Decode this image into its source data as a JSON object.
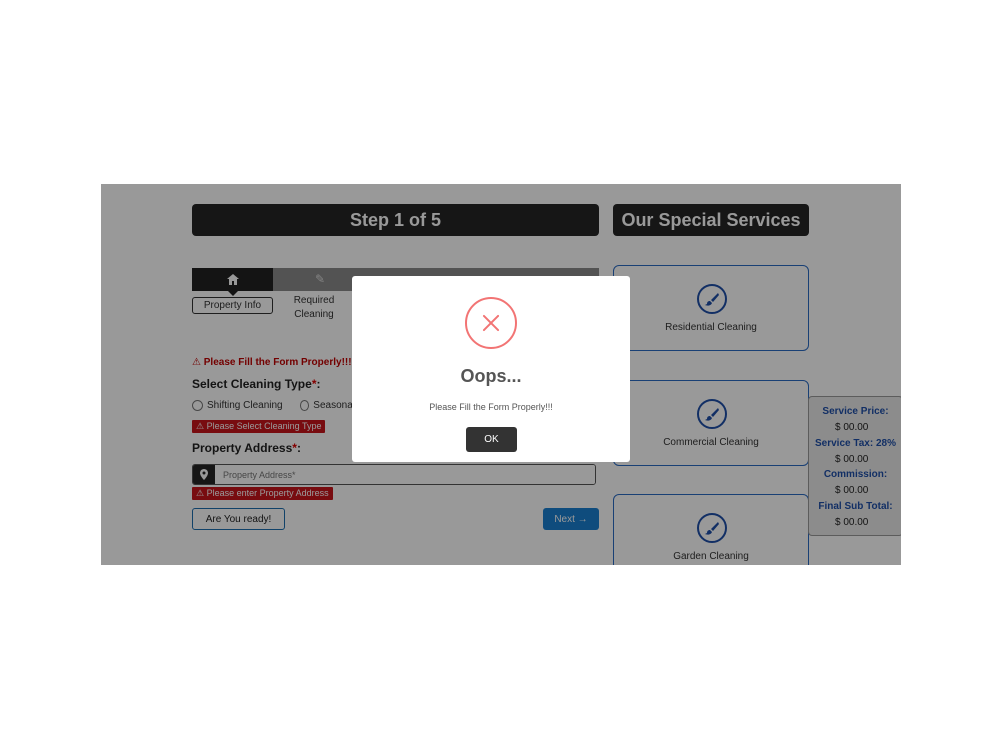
{
  "step": {
    "title": "Step 1 of 5",
    "tabs": [
      {
        "label": "Property Info",
        "icon": "home-icon"
      },
      {
        "label": "Required Cleaning",
        "icon": "brush-icon"
      }
    ]
  },
  "form": {
    "error_banner": "⚠ Please Fill the Form Properly!!!",
    "cleaning_type": {
      "label": "Select Cleaning Type",
      "required_mark": "*",
      "suffix": ":",
      "options": [
        "Shifting Cleaning",
        "Seasonal"
      ],
      "error": "⚠ Please Select Cleaning Type"
    },
    "address": {
      "label": "Property Address",
      "required_mark": "*",
      "suffix": ":",
      "placeholder": "Property Address*",
      "error": "⚠ Please enter Property Address"
    },
    "ready_button": "Are You ready!",
    "next_button": "Next →"
  },
  "services": {
    "title": "Our Special Services",
    "items": [
      {
        "label": "Residential Cleaning",
        "icon": "brush-icon"
      },
      {
        "label": "Commercial Cleaning",
        "icon": "brush-icon"
      },
      {
        "label": "Garden Cleaning",
        "icon": "brush-icon"
      }
    ]
  },
  "pricing": {
    "service_price_label": "Service Price:",
    "service_price_value": "$  00.00",
    "service_tax_label": "Service Tax: 28%",
    "service_tax_value": "$  00.00",
    "commission_label": "Commission:",
    "commission_value": "$  00.00",
    "final_label": "Final Sub Total:",
    "final_value": "$  00.00"
  },
  "dialog": {
    "title": "Oops...",
    "message": "Please Fill the Form Properly!!!",
    "ok_button": "OK",
    "icon": "error-x-icon"
  },
  "colors": {
    "accent_blue": "#1a7fd0",
    "error_red": "#c9141c",
    "dialog_icon": "#f27474",
    "dark_bar": "#262626"
  }
}
